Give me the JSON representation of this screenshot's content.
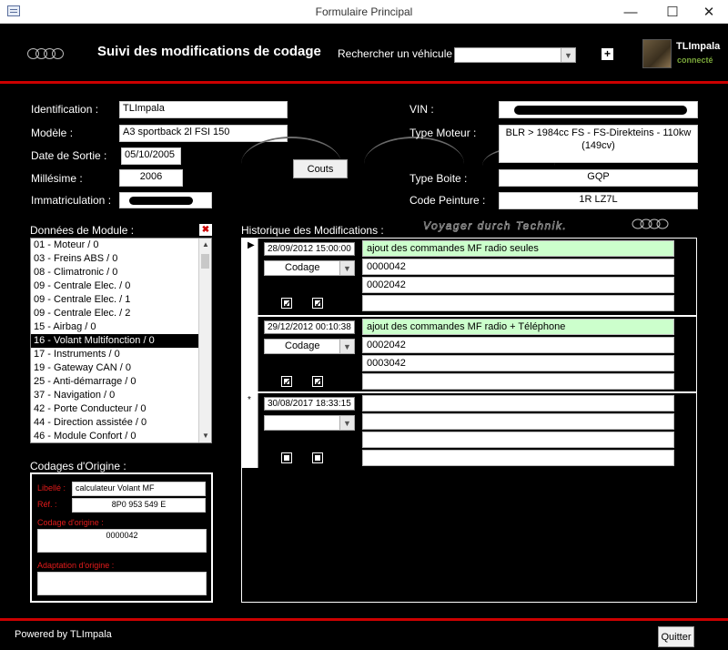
{
  "window": {
    "title": "Formulaire Principal",
    "minimize": "—",
    "maximize": "☐",
    "close": "✕"
  },
  "header": {
    "title": "Suivi des modifications de codage",
    "search_label": "Rechercher un véhicule :",
    "search_value": "",
    "add_glyph": "+",
    "user_name": "TLImpala",
    "user_status": "connecté"
  },
  "vehicle": {
    "identification_label": "Identification :",
    "identification": "TLImpala",
    "modele_label": "Modèle :",
    "modele": "A3 sportback 2l FSI 150",
    "date_sortie_label": "Date de Sortie :",
    "date_sortie": "05/10/2005",
    "millesime_label": "Millésime :",
    "millesime": "2006",
    "immatriculation_label": "Immatriculation :",
    "vin_label": "VIN :",
    "type_moteur_label": "Type Moteur :",
    "type_moteur": "BLR > 1984cc FS - FS-Direkteins - 110kw (149cv)",
    "type_boite_label": "Type Boite :",
    "type_boite": "GQP",
    "code_peinture_label": "Code Peinture :",
    "code_peinture": "1R LZ7L",
    "couts_button": "Couts"
  },
  "modules": {
    "label": "Données de Module :",
    "items": [
      "01 - Moteur / 0",
      "03 - Freins ABS / 0",
      "08 - Climatronic / 0",
      "09 - Centrale Elec. / 0",
      "09 - Centrale Elec. / 1",
      "09 - Centrale Elec. / 2",
      "15 - Airbag / 0",
      "16 - Volant Multifonction / 0",
      "17 - Instruments / 0",
      "19 - Gateway CAN / 0",
      "25 - Anti-démarrage / 0",
      "37 - Navigation / 0",
      "42 - Porte Conducteur / 0",
      "44 - Direction assistée / 0",
      "46 - Module Confort / 0"
    ],
    "selected_index": 7
  },
  "origin": {
    "label": "Codages d'Origine :",
    "libelle_label": "Libellé :",
    "libelle": "calculateur Volant MF",
    "ref_label": "Réf. :",
    "ref": "8P0 953 549 E",
    "codage_label": "Codage d'origine :",
    "codage": "0000042",
    "adaptation_label": "Adaptation d'origine :",
    "adaptation": ""
  },
  "history": {
    "label": "Historique des Modifications :",
    "banner": "Voyager durch Technik.",
    "records": [
      {
        "marker": "▶",
        "date": "28/09/2012 15:00:00",
        "type": "Codage",
        "description": "ajout des commandes MF radio seules",
        "old_value": "0000042",
        "new_value": "0002042",
        "extra": "",
        "check1": "✓",
        "check2": "✓"
      },
      {
        "marker": "",
        "date": "29/12/2012 00:10:38",
        "type": "Codage",
        "description": "ajout des commandes MF radio + Téléphone",
        "old_value": "0002042",
        "new_value": "0003042",
        "extra": "",
        "check1": "✓",
        "check2": "✓"
      },
      {
        "marker": "*",
        "date": "30/08/2017 18:33:15",
        "type": "",
        "description": "",
        "old_value": "",
        "new_value": "",
        "extra": "",
        "check1": "",
        "check2": ""
      }
    ]
  },
  "footer": {
    "text": "Powered by TLImpala",
    "quit_button": "Quitter"
  }
}
